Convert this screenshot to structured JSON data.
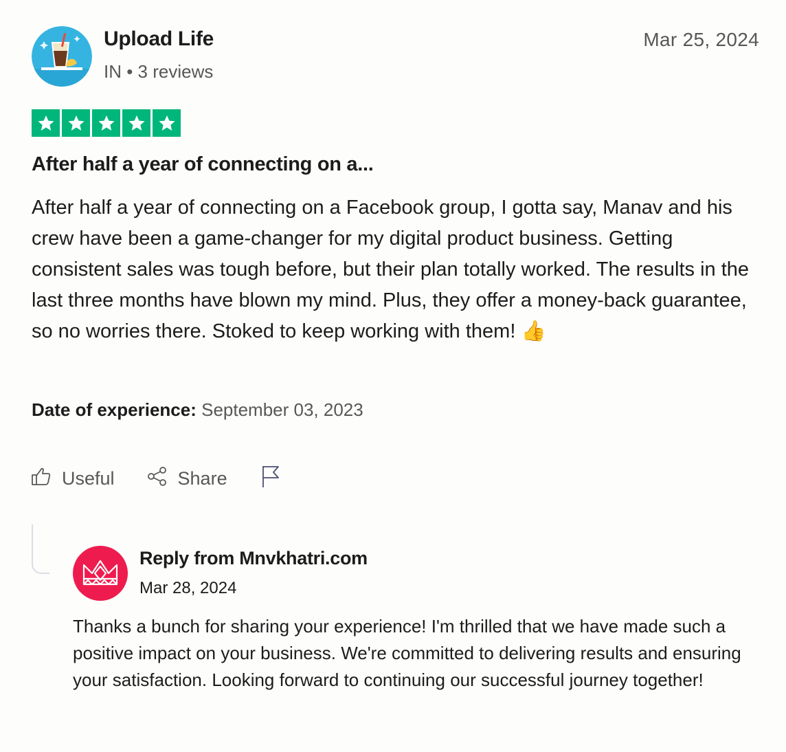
{
  "reviewer": {
    "name": "Upload Life",
    "meta": "IN • 3 reviews"
  },
  "review": {
    "date": "Mar 25, 2024",
    "rating": 5,
    "title": "After half a year of connecting on a...",
    "body": "After half a year of connecting on a Facebook group, I gotta say, Manav and his crew have been a game-changer for my digital product business. Getting consistent sales was tough before, but their plan totally worked. The results in the last three months have blown my mind. Plus, they offer a money-back guarantee, so no worries there. Stoked to keep working with them! 👍",
    "experience_label": "Date of experience:",
    "experience_date": "September 03, 2023",
    "star_color": "#00b67a"
  },
  "actions": {
    "useful_label": "Useful",
    "share_label": "Share",
    "useful_icon": "thumbs-up-icon",
    "share_icon": "share-icon",
    "report_icon": "flag-icon"
  },
  "reply": {
    "from": "Reply from Mnvkhatri.com",
    "date": "Mar 28, 2024",
    "body": "Thanks a bunch for sharing your experience! I'm thrilled that we have made such a positive impact on your business. We're committed to delivering results and ensuring your satisfaction. Looking forward to continuing our successful journey together!",
    "avatar_color": "#ee1c4e",
    "avatar_icon": "crown-logo-icon"
  }
}
